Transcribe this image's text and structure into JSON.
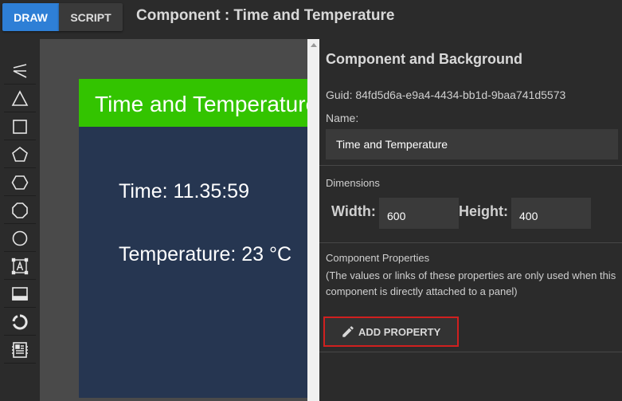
{
  "modes": {
    "draw_label": "DRAW",
    "script_label": "SCRIPT"
  },
  "header": {
    "title": "Component : Time and Temperature"
  },
  "toolbar": {
    "tools": [
      "line-tool-icon",
      "triangle-tool-icon",
      "square-tool-icon",
      "pentagon-tool-icon",
      "hexagon-tool-icon",
      "octagon-tool-icon",
      "circle-tool-icon",
      "text-tool-icon",
      "panel-tool-icon",
      "gauge-tool-icon",
      "widget-tool-icon"
    ]
  },
  "preview": {
    "title": "Time and Temperature",
    "time_text": "Time: 11.35:59",
    "temperature_text": "Temperature: 23 °C",
    "header_color": "#33c400",
    "body_color": "#263651"
  },
  "properties": {
    "section_title": "Component and Background",
    "guid": "Guid: 84fd5d6a-e9a4-4434-bb1d-9baa741d5573",
    "name_label": "Name:",
    "name_value": "Time and Temperature",
    "dimensions_title": "Dimensions",
    "width_label": "Width:",
    "width_value": "600",
    "height_label": "Height:",
    "height_value": "400",
    "component_props_title": "Component Properties",
    "component_props_note": "(The values or links of these properties are only used when this component is directly attached to a panel)",
    "add_property_label": "ADD PROPERTY"
  },
  "colors": {
    "accent": "#2e7fd6",
    "highlight_border": "#d0201f"
  }
}
